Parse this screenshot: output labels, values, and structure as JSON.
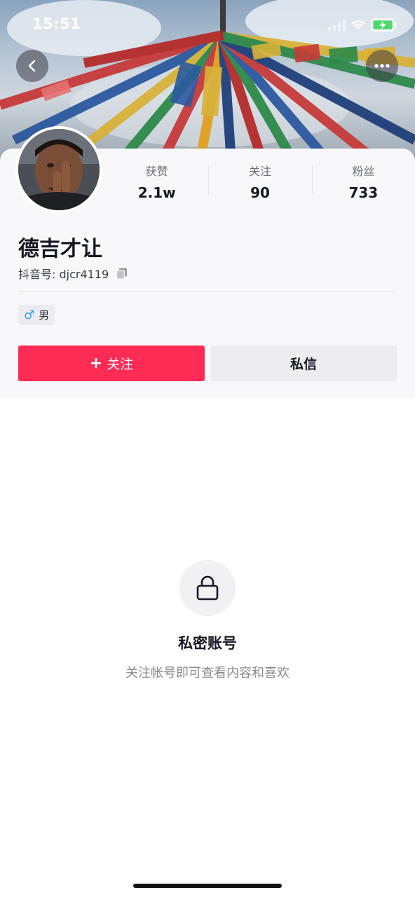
{
  "status_bar": {
    "time": "15:51"
  },
  "header": {
    "back_icon": "chevron-left-icon",
    "more_icon": "ellipsis-icon"
  },
  "profile": {
    "name": "德吉才让",
    "douyin_id": "抖音号: djcr4119",
    "gender": "男",
    "stats": [
      {
        "label": "获赞",
        "value": "2.1w"
      },
      {
        "label": "关注",
        "value": "90"
      },
      {
        "label": "粉丝",
        "value": "733"
      }
    ]
  },
  "actions": {
    "follow_label": "关注",
    "message_label": "私信"
  },
  "private_notice": {
    "title": "私密账号",
    "description": "关注帐号即可查看内容和喜欢"
  },
  "colors": {
    "accent": "#fe2c55",
    "gender_male": "#2d9ce6"
  }
}
